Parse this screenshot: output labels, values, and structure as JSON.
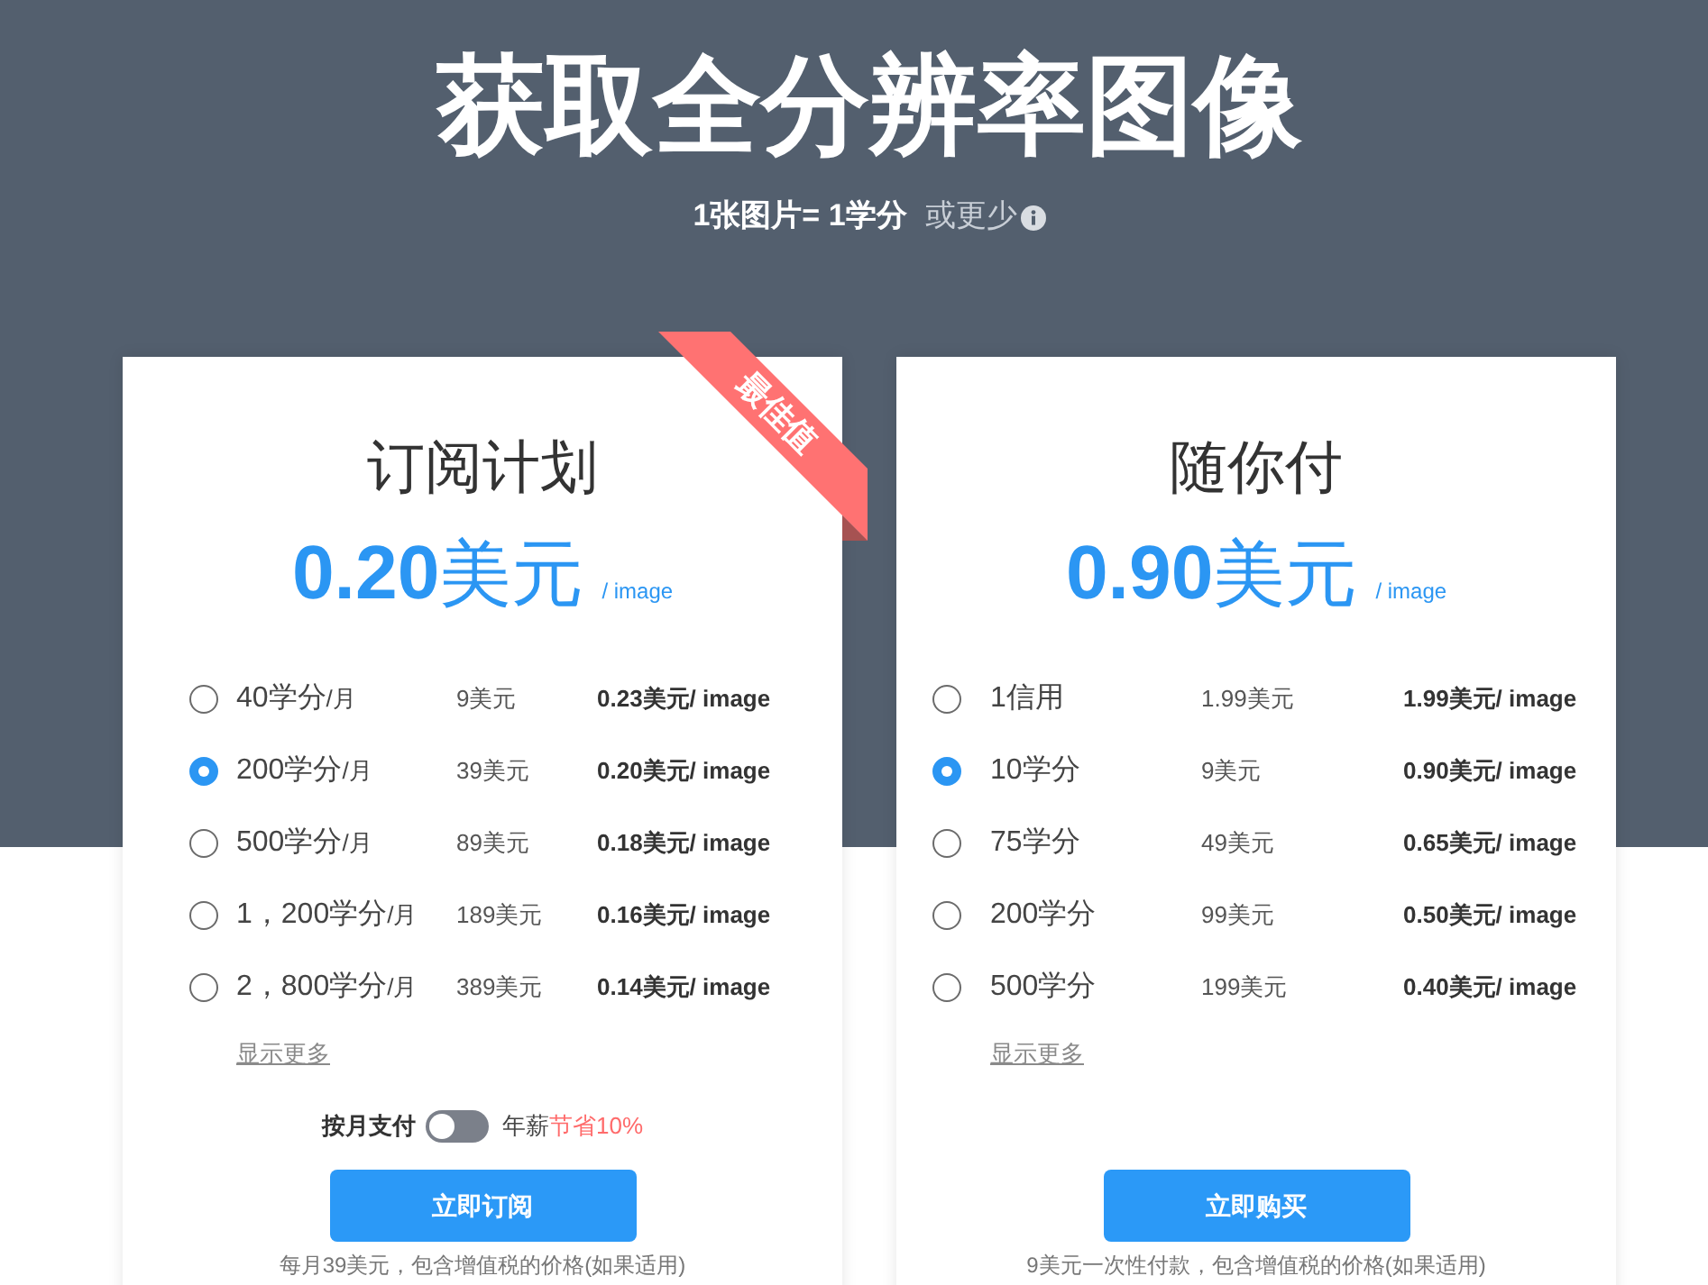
{
  "header": {
    "title": "获取全分辨率图像",
    "subtitle": "1张图片= 1学分",
    "subtitle_note": "或更少"
  },
  "plans": [
    {
      "kind": "subscription",
      "title": "订阅计划",
      "ribbon": "最佳值",
      "price": "0.20",
      "currency": "美元",
      "unit": "/ image",
      "options": [
        {
          "credits": "40学分",
          "period": "/月",
          "price": "9美元",
          "per_image": "0.23美元/ image",
          "selected": false
        },
        {
          "credits": "200学分",
          "period": "/月",
          "price": "39美元",
          "per_image": "0.20美元/ image",
          "selected": true
        },
        {
          "credits": "500学分",
          "period": "/月",
          "price": "89美元",
          "per_image": "0.18美元/ image",
          "selected": false
        },
        {
          "credits": "1，200学分",
          "period": "/月",
          "price": "189美元",
          "per_image": "0.16美元/ image",
          "selected": false
        },
        {
          "credits": "2，800学分",
          "period": "/月",
          "price": "389美元",
          "per_image": "0.14美元/ image",
          "selected": false
        }
      ],
      "show_more": "显示更多",
      "billing_toggle": {
        "left_label": "按月支付",
        "right_label": "年薪",
        "savings": "节省10%",
        "on": false
      },
      "button": "立即订阅",
      "footnote": "每月39美元，包含增值税的价格(如果适用)"
    },
    {
      "kind": "one_time",
      "title": "随你付",
      "price": "0.90",
      "currency": "美元",
      "unit": "/ image",
      "options": [
        {
          "credits": "1信用",
          "price": "1.99美元",
          "per_image": "1.99美元/ image",
          "selected": false
        },
        {
          "credits": "10学分",
          "price": "9美元",
          "per_image": "0.90美元/ image",
          "selected": true
        },
        {
          "credits": "75学分",
          "price": "49美元",
          "per_image": "0.65美元/ image",
          "selected": false
        },
        {
          "credits": "200学分",
          "price": "99美元",
          "per_image": "0.50美元/ image",
          "selected": false
        },
        {
          "credits": "500学分",
          "price": "199美元",
          "per_image": "0.40美元/ image",
          "selected": false
        }
      ],
      "show_more": "显示更多",
      "button": "立即购买",
      "footnote": "9美元一次性付款，包含增值税的价格(如果适用)"
    }
  ]
}
